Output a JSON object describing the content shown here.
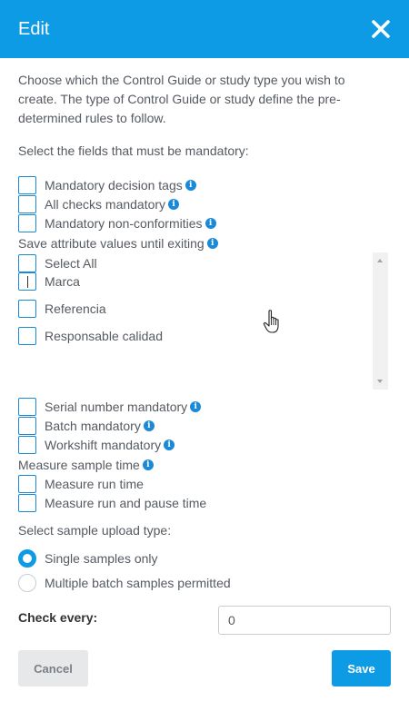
{
  "header": {
    "title": "Edit",
    "close_icon": "close-icon",
    "background": "#0d9be6"
  },
  "intro_text": "Choose which the Control Guide or study type you wish to create. The type of Control Guide or study define the pre-determined rules to follow.",
  "mandatory_section": {
    "label": "Select the fields that must be mandatory:",
    "options": [
      {
        "label": "Mandatory decision tags",
        "info": true,
        "checked": false
      },
      {
        "label": "All checks mandatory",
        "info": true,
        "checked": false
      },
      {
        "label": "Mandatory non-conformities",
        "info": true,
        "checked": false
      }
    ]
  },
  "save_attributes": {
    "label": "Save attribute values until exiting",
    "info": true,
    "list": [
      {
        "label": "Select All",
        "checked": false
      },
      {
        "label": "Marca",
        "checked": false
      },
      {
        "label": "Referencia",
        "checked": false
      },
      {
        "label": "Responsable calidad",
        "checked": false
      }
    ]
  },
  "more_options": [
    {
      "label": "Serial number mandatory",
      "info": true,
      "checked": false
    },
    {
      "label": "Batch mandatory",
      "info": true,
      "checked": false
    },
    {
      "label": "Workshift mandatory",
      "info": true,
      "checked": false
    }
  ],
  "measure_sample_time": {
    "label": "Measure sample time",
    "info": true,
    "options": [
      {
        "label": "Measure run time",
        "checked": false
      },
      {
        "label": "Measure run and pause time",
        "checked": false
      }
    ]
  },
  "sample_upload": {
    "label": "Select sample upload type:",
    "options": [
      {
        "label": "Single samples only",
        "selected": true
      },
      {
        "label": "Multiple batch samples permitted",
        "selected": false
      }
    ]
  },
  "check_every": {
    "label": "Check every:",
    "value": "0"
  },
  "buttons": {
    "cancel": "Cancel",
    "save": "Save"
  },
  "colors": {
    "accent": "#0d9be6",
    "checkbox_border": "#1a8ad8",
    "text": "#555a60"
  }
}
